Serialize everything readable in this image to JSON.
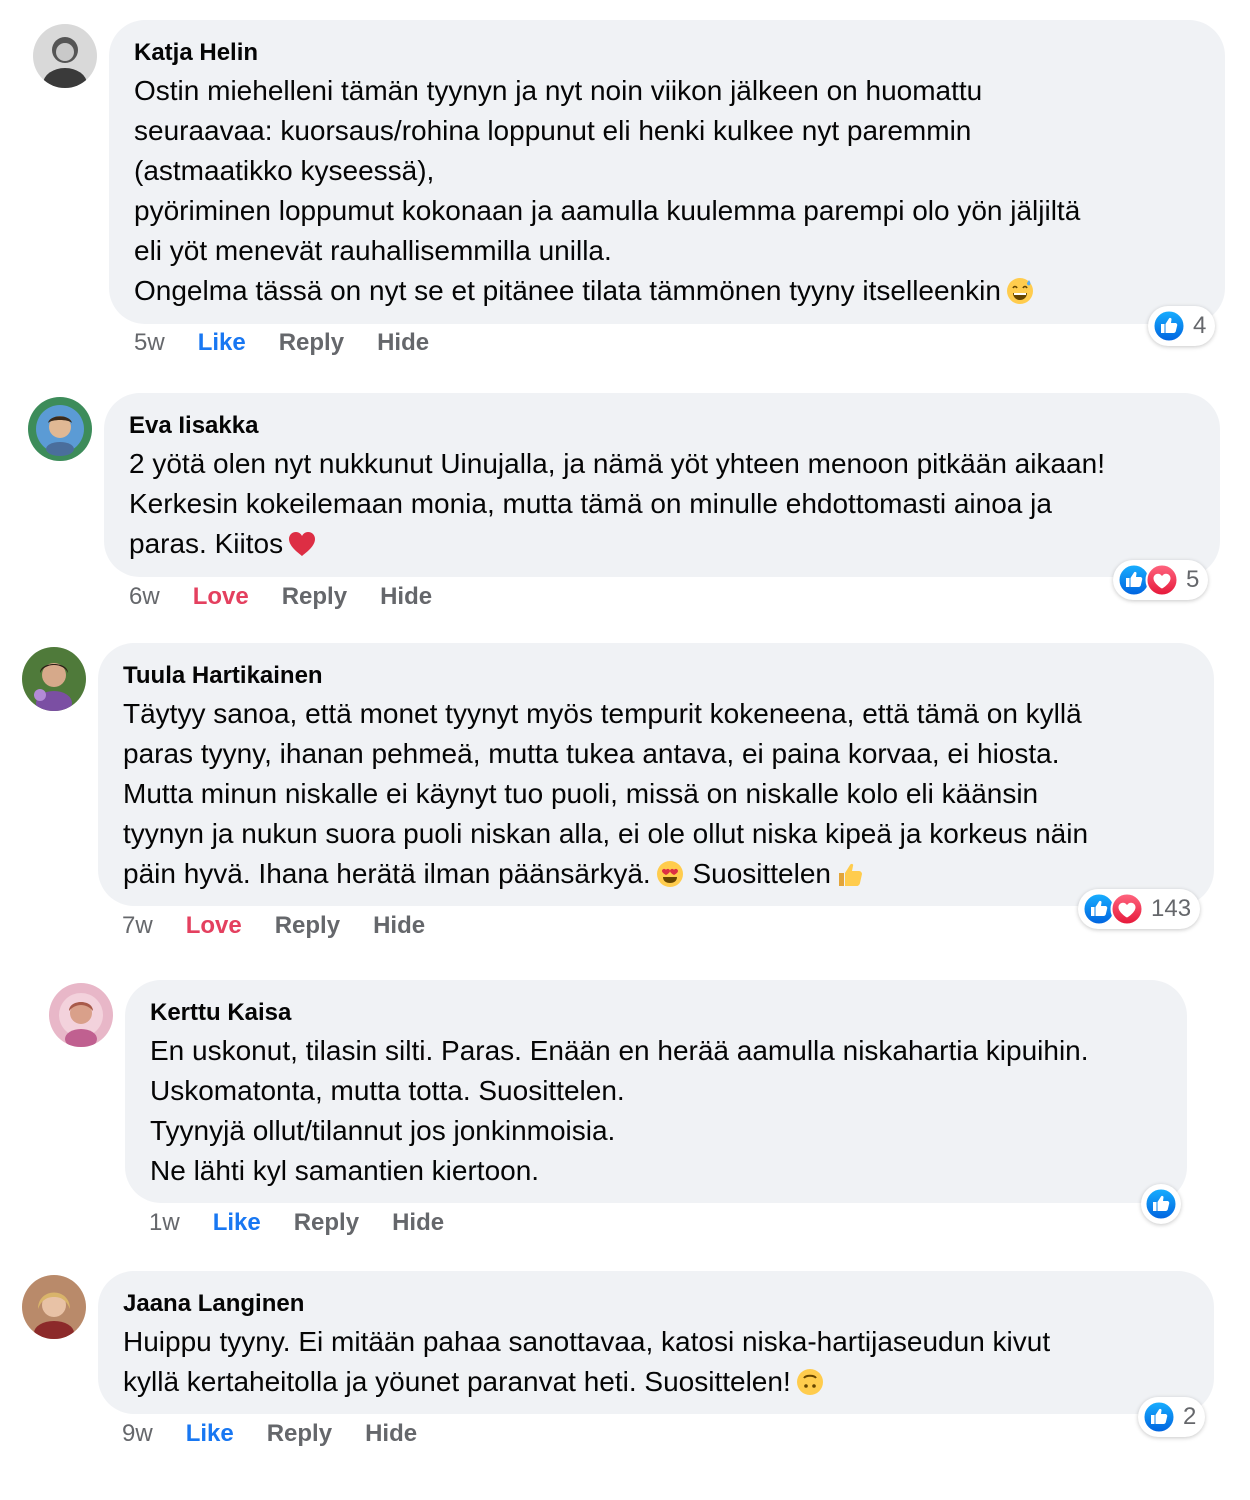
{
  "comments": [
    {
      "name": "Katja Helin",
      "text": "Ostin miehelleni tämän tyynyn ja nyt noin viikon jälkeen on huomattu\nseuraavaa: kuorsaus/rohina loppunut eli henki kulkee nyt paremmin\n(astmaatikko kyseessä),\npyöriminen loppumut kokonaan ja aamulla kuulemma parempi olo yön jäljiltä\neli yöt menevät rauhallisemmilla unilla.\nOngelma tässä on nyt se et pitänee tilata tämmönen tyyny itselleenkin",
      "emoji": "grinning-sweat-emoji",
      "time": "5w",
      "reaction_label": "Like",
      "reply_label": "Reply",
      "hide_label": "Hide",
      "reaction_count": "4",
      "reaction_icons": [
        "like-icon"
      ]
    },
    {
      "name": "Eva Iisakka",
      "text": "2 yötä olen nyt nukkunut Uinujalla, ja nämä yöt yhteen menoon pitkään aikaan!\nKerkesin kokeilemaan monia, mutta tämä on minulle ehdottomasti ainoa ja\nparas. Kiitos",
      "emoji": "red-heart-emoji",
      "time": "6w",
      "reaction_label": "Love",
      "reply_label": "Reply",
      "hide_label": "Hide",
      "reaction_count": "5",
      "reaction_icons": [
        "like-icon",
        "love-icon"
      ]
    },
    {
      "name": "Tuula Hartikainen",
      "text": "Täytyy sanoa, että monet tyynyt myös tempurit kokeneena, että tämä on kyllä\nparas tyyny, ihanan pehmeä, mutta tukea antava, ei paina korvaa, ei hiosta.\nMutta minun niskalle ei käynyt tuo puoli, missä on niskalle kolo eli käänsin\ntyynyn ja nukun suora puoli niskan alla, ei ole ollut niska kipeä ja korkeus näin\npäin hyvä. Ihana herätä ilman päänsärkyä.",
      "text_tail": "Suosittelen",
      "emoji": "heart-eyes-emoji",
      "emoji2": "thumbs-up-emoji",
      "time": "7w",
      "reaction_label": "Love",
      "reply_label": "Reply",
      "hide_label": "Hide",
      "reaction_count": "143",
      "reaction_icons": [
        "like-icon",
        "love-icon"
      ]
    },
    {
      "name": "Kerttu Kaisa",
      "text": "En uskonut, tilasin silti. Paras. Enään en herää aamulla niskahartia kipuihin.\nUskomatonta, mutta totta. Suosittelen.\nTyynyjä ollut/tilannut jos jonkinmoisia.\nNe lähti kyl samantien kiertoon.",
      "time": "1w",
      "reaction_label": "Like",
      "reply_label": "Reply",
      "hide_label": "Hide",
      "reaction_count": "",
      "reaction_icons": [
        "like-icon"
      ]
    },
    {
      "name": "Jaana Langinen",
      "text": "Huippu tyyny. Ei mitään pahaa sanottavaa, katosi niska-hartijaseudun kivut\nkyllä kertaheitolla ja yöunet paranvat heti. Suosittelen!",
      "emoji": "upside-down-face-emoji",
      "time": "9w",
      "reaction_label": "Like",
      "reply_label": "Reply",
      "hide_label": "Hide",
      "reaction_count": "2",
      "reaction_icons": [
        "like-icon"
      ]
    }
  ],
  "colors": {
    "bubble": "#f0f2f5",
    "like_blue": "#1877f2",
    "love_red": "#e4405f",
    "meta_gray": "#65676b"
  }
}
